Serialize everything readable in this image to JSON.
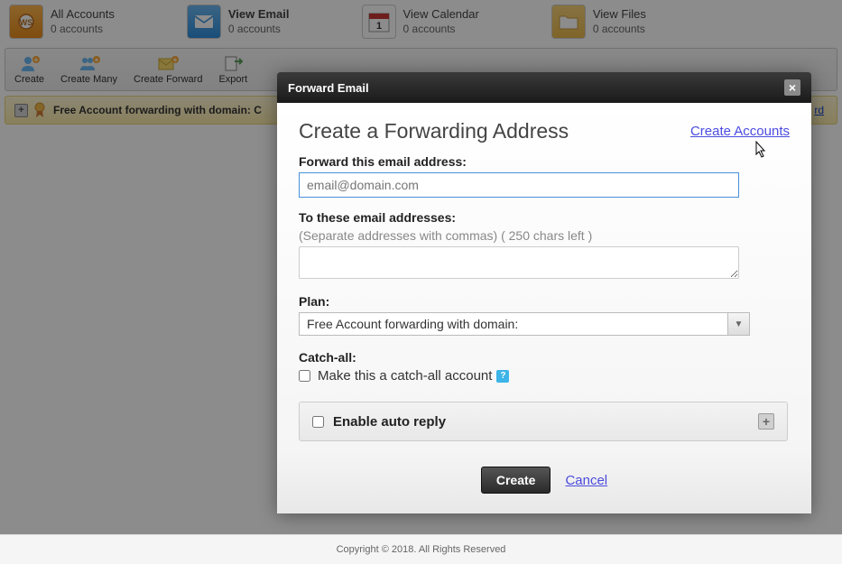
{
  "header": {
    "tabs": [
      {
        "title": "All Accounts",
        "sub": "0 accounts"
      },
      {
        "title": "View Email",
        "sub": "0 accounts"
      },
      {
        "title": "View Calendar",
        "sub": "0 accounts"
      },
      {
        "title": "View Files",
        "sub": "0 accounts"
      }
    ]
  },
  "toolbar": {
    "create": "Create",
    "create_many": "Create Many",
    "create_forward": "Create Forward",
    "export": "Export"
  },
  "notice": {
    "text": "Free Account forwarding with domain: C",
    "link": "rd"
  },
  "modal": {
    "title": "Forward Email",
    "heading": "Create a Forwarding Address",
    "create_accounts_link": "Create Accounts",
    "forward_label": "Forward this email address:",
    "forward_placeholder": "email@domain.com",
    "to_label": "To these email addresses:",
    "to_hint": "(Separate addresses with commas) ( 250 chars left )",
    "plan_label": "Plan:",
    "plan_selected": "Free Account forwarding with domain:",
    "catchall_label": "Catch-all:",
    "catchall_checkbox": "Make this a catch-all account",
    "autoreply_label": "Enable auto reply",
    "create_btn": "Create",
    "cancel_btn": "Cancel"
  },
  "footer": "Copyright © 2018. All Rights Reserved"
}
